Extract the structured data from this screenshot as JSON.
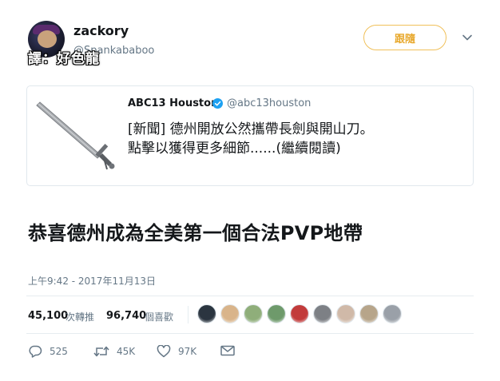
{
  "tweet": {
    "username": "zackory",
    "handle": "@Spankababoo",
    "watermark": "譯：好色龍",
    "follow_label": "跟隨",
    "main_text": "恭喜德州成為全美第一個合法PVP地帶",
    "timestamp": "上午9:42 - 2017年11月13日"
  },
  "quote": {
    "name": "ABC13 Houston",
    "handle": "@abc13houston",
    "line1": "[新聞] 德州開放公然攜帶長劍與開山刀。",
    "line2_text": "點擊以獲得更多細節......",
    "line2_link": "(繼續閱讀)"
  },
  "stats": {
    "retweets_count": "45,100",
    "retweets_label": "次轉推",
    "likes_count": "96,740",
    "likes_label": "個喜歡"
  },
  "actions": {
    "reply_count": "525",
    "retweet_count": "45K",
    "like_count": "97K"
  },
  "icons": {
    "reply": "reply-icon",
    "retweet": "retweet-icon",
    "like": "heart-icon",
    "dm": "envelope-icon",
    "more": "chevron-down-icon",
    "verified": "verified-badge-icon"
  },
  "colors": {
    "follow_accent": "#e8a92e",
    "verified_blue": "#1da1f2",
    "muted": "#657786"
  },
  "likers": [
    {
      "color": "#2b3540"
    },
    {
      "color": "#d9b48a"
    },
    {
      "color": "#8fae7a"
    },
    {
      "color": "#6e9a6b"
    },
    {
      "color": "#c23b3b"
    },
    {
      "color": "#7d8085"
    },
    {
      "color": "#d0b9a8"
    },
    {
      "color": "#b7a58a"
    },
    {
      "color": "#9aa0a8"
    }
  ]
}
